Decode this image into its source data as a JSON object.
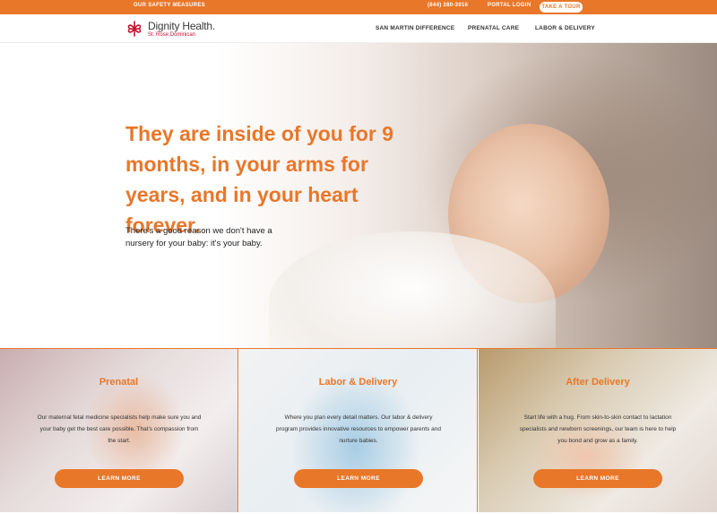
{
  "topbar": {
    "safety_label": "OUR SAFETY MEASURES",
    "phone": "(844) 280-3916",
    "portal_label": "PORTAL LOGIN",
    "tour_label": "TAKE A TOUR"
  },
  "header": {
    "logo_name": "Dignity Health.",
    "logo_sub": "St. Rose Dominican",
    "nav": [
      {
        "label": "SAN MARTIN DIFFERENCE"
      },
      {
        "label": "PRENATAL CARE"
      },
      {
        "label": "LABOR & DELIVERY"
      }
    ]
  },
  "hero": {
    "title": "They are inside of you for 9 months, in your arms for years, and in your heart forever.",
    "subtitle": "There's a good reason we don't have a nursery for your baby: it's your baby."
  },
  "cards": [
    {
      "title": "Prenatal",
      "text": "Our maternal fetal medicine specialists help make sure you and your baby get the best care possible. That's compassion from the start.",
      "button": "LEARN MORE"
    },
    {
      "title": "Labor & Delivery",
      "text": "Where you plan every detail matters. Our labor & delivery program provides innovative resources to empower parents and nurture babies.",
      "button": "LEARN MORE"
    },
    {
      "title": "After Delivery",
      "text": "Start life with a hug. From skin-to-skin contact to lactation specialists and newborn screenings, our team is here to help you bond and grow as a family.",
      "button": "LEARN MORE"
    }
  ],
  "colors": {
    "accent": "#e8772a",
    "logo_red": "#c8102e"
  }
}
